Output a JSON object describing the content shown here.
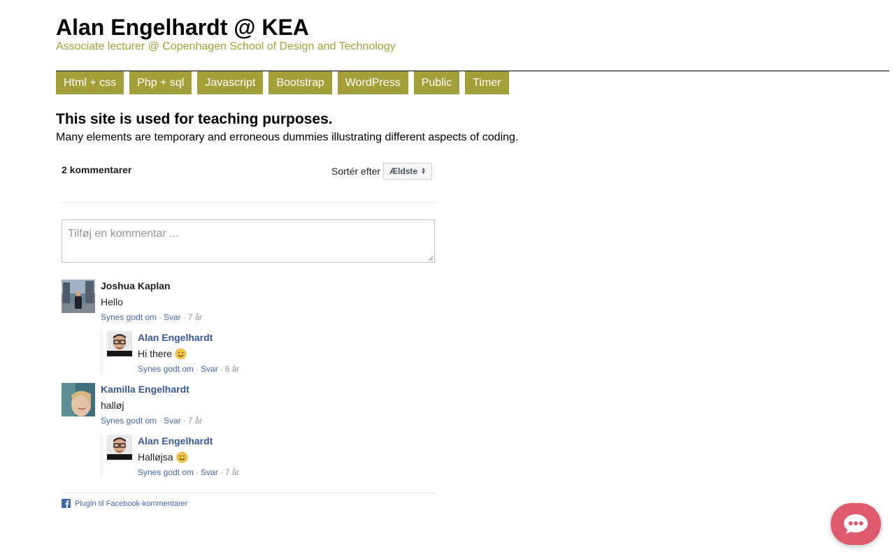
{
  "header": {
    "title": "Alan Engelhardt @ KEA",
    "subtitle": "Associate lecturer @ Copenhagen School of Design and Technology"
  },
  "nav": {
    "items": [
      {
        "label": "Html + css"
      },
      {
        "label": "Php + sql"
      },
      {
        "label": "Javascript"
      },
      {
        "label": "Bootstrap"
      },
      {
        "label": "WordPress"
      },
      {
        "label": "Public"
      },
      {
        "label": "Timer"
      }
    ]
  },
  "intro": {
    "heading": "This site is used for teaching purposes.",
    "text": "Many elements are temporary and erroneous dummies illustrating different aspects of coding."
  },
  "comments_plugin": {
    "count_label": "2 kommentarer",
    "sort_label": "Sortér efter",
    "sort_value": "Ældste",
    "input_placeholder": "Tilføj en kommentar ...",
    "action_like": "Synes godt om",
    "action_reply": "Svar",
    "comments": [
      {
        "author": "Joshua Kaplan",
        "text": "Hello",
        "age": "7 år",
        "reply": {
          "author": "Alan Engelhardt",
          "text": "Hi there",
          "emoji": "smiley",
          "age": "6 år"
        }
      },
      {
        "author": "Kamilla Engelhardt",
        "text": "halløj",
        "age": "7 år",
        "reply": {
          "author": "Alan Engelhardt",
          "text": "Halløjsa",
          "emoji": "smiley",
          "age": "7 år"
        }
      }
    ],
    "footer_label": "Plugin til Facebook-kommentarer"
  },
  "colors": {
    "accent": "#a3a039",
    "fb_link": "#385898",
    "fb_action": "#4267b2",
    "chat_bubble": "#e05a6d"
  },
  "icons": {
    "chat": "chat-bubble-icon",
    "facebook": "facebook-icon",
    "sort": "sort-arrows-icon"
  }
}
